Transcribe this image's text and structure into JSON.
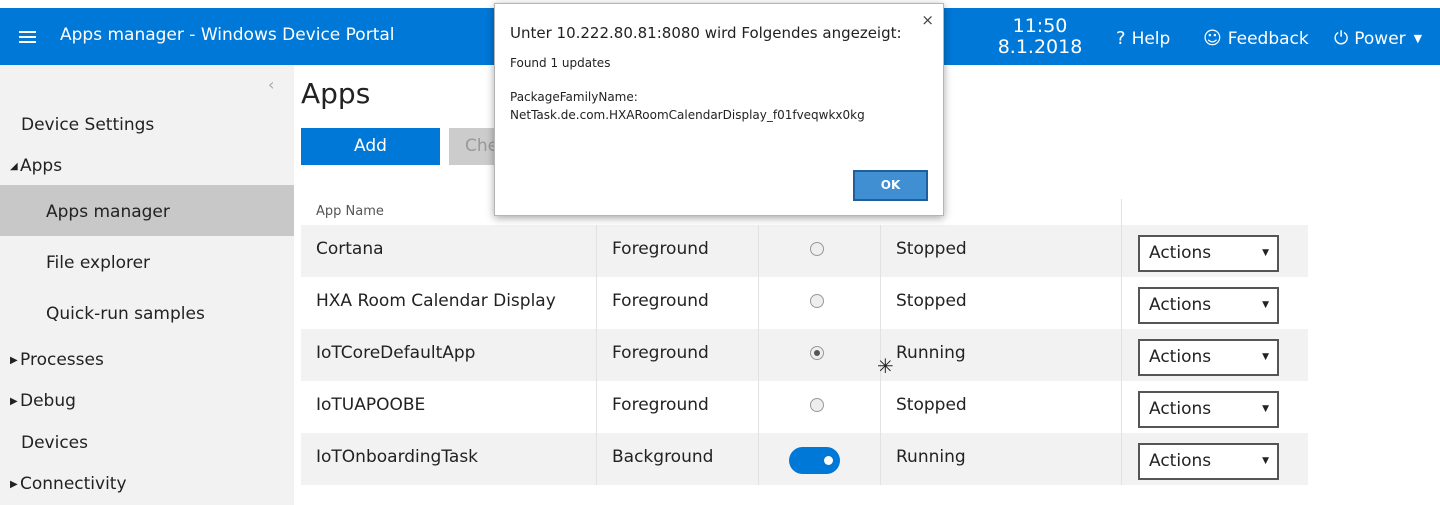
{
  "header": {
    "title": "Apps manager - Windows Device Portal",
    "time": "11:50",
    "date": "8.1.2018",
    "help_label": "Help",
    "feedback_label": "Feedback",
    "power_label": "Power",
    "accent": "#0078d7"
  },
  "sidebar": {
    "collapse_glyph": "‹",
    "items": [
      {
        "label": "Device Settings"
      },
      {
        "label": "Apps",
        "expanded": true
      },
      {
        "label": "Apps manager",
        "active": true
      },
      {
        "label": "File explorer"
      },
      {
        "label": "Quick-run samples"
      },
      {
        "label": "Processes",
        "expanded": false
      },
      {
        "label": "Debug",
        "expanded": false
      },
      {
        "label": "Devices"
      },
      {
        "label": "Connectivity",
        "expanded": false
      }
    ]
  },
  "main": {
    "heading": "Apps",
    "add_label": "Add",
    "check_label": "Che",
    "table": {
      "header_app_name": "App Name",
      "rows": [
        {
          "name": "Cortana",
          "type": "Foreground",
          "startup": "radio-off",
          "status": "Stopped",
          "actions": "Actions"
        },
        {
          "name": "HXA Room Calendar Display",
          "type": "Foreground",
          "startup": "radio-off",
          "status": "Stopped",
          "actions": "Actions"
        },
        {
          "name": "IoTCoreDefaultApp",
          "type": "Foreground",
          "startup": "radio-on",
          "status": "Running",
          "actions": "Actions"
        },
        {
          "name": "IoTUAPOOBE",
          "type": "Foreground",
          "startup": "radio-off",
          "status": "Stopped",
          "actions": "Actions"
        },
        {
          "name": "IoTOnboardingTask",
          "type": "Background",
          "startup": "toggle-on",
          "status": "Running",
          "actions": "Actions"
        }
      ]
    }
  },
  "dialog": {
    "title": "Unter 10.222.80.81:8080 wird Folgendes angezeigt:",
    "message_line1": "Found 1 updates",
    "message_line2": "PackageFamilyName:",
    "message_line3": "NetTask.de.com.HXARoomCalendarDisplay_f01fveqwkx0kg",
    "ok_label": "OK",
    "close_glyph": "×"
  }
}
